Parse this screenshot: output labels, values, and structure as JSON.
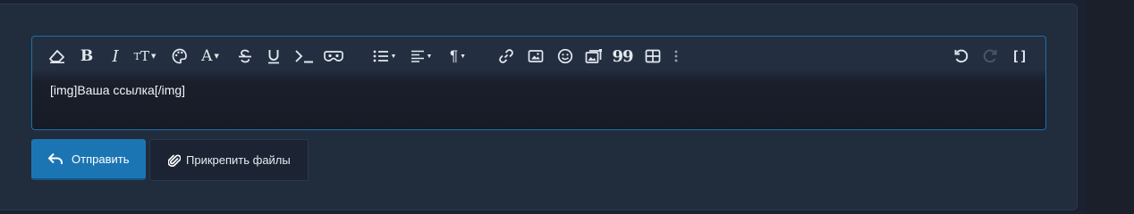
{
  "editor": {
    "content": "[img]Ваша ссылка[/img]"
  },
  "toolbar": {
    "buttons": [
      {
        "icon": "eraser-icon",
        "name": "clear-formatting"
      },
      {
        "icon": "bold-icon",
        "name": "bold",
        "glyph": "B"
      },
      {
        "icon": "italic-icon",
        "name": "italic",
        "glyph": "I"
      },
      {
        "icon": "text-size-icon",
        "name": "text-size",
        "glyph": "тТ"
      },
      {
        "icon": "palette-icon",
        "name": "text-color"
      },
      {
        "icon": "font-family-icon",
        "name": "font-family",
        "glyph": "A"
      },
      {
        "icon": "strikethrough-icon",
        "name": "strikethrough",
        "glyph": "S"
      },
      {
        "icon": "underline-icon",
        "name": "underline",
        "glyph": "U"
      },
      {
        "icon": "code-icon",
        "name": "inline-code"
      },
      {
        "icon": "spoiler-icon",
        "name": "spoiler"
      },
      {
        "icon": "list-icon",
        "name": "list"
      },
      {
        "icon": "align-icon",
        "name": "alignment"
      },
      {
        "icon": "paragraph-icon",
        "name": "paragraph",
        "glyph": "¶"
      },
      {
        "icon": "link-icon",
        "name": "insert-link"
      },
      {
        "icon": "image-icon",
        "name": "insert-image"
      },
      {
        "icon": "smiley-icon",
        "name": "insert-smilie"
      },
      {
        "icon": "media-icon",
        "name": "insert-media"
      },
      {
        "icon": "quote-icon",
        "name": "insert-quote",
        "glyph": "99"
      },
      {
        "icon": "table-icon",
        "name": "insert-table"
      },
      {
        "icon": "more-vertical-icon",
        "name": "more-options"
      },
      {
        "icon": "undo-icon",
        "name": "undo"
      },
      {
        "icon": "redo-icon",
        "name": "redo"
      },
      {
        "icon": "bbcode-toggle-icon",
        "name": "toggle-bbcode",
        "glyph": "[ ]"
      }
    ]
  },
  "actions": {
    "submit_label": "Отправить",
    "attach_label": "Прикрепить файлы"
  },
  "colors": {
    "accent": "#1c75b3",
    "editor_border": "#1d6fa5",
    "panel_bg": "#212c3d",
    "text": "#e3e8ef"
  }
}
